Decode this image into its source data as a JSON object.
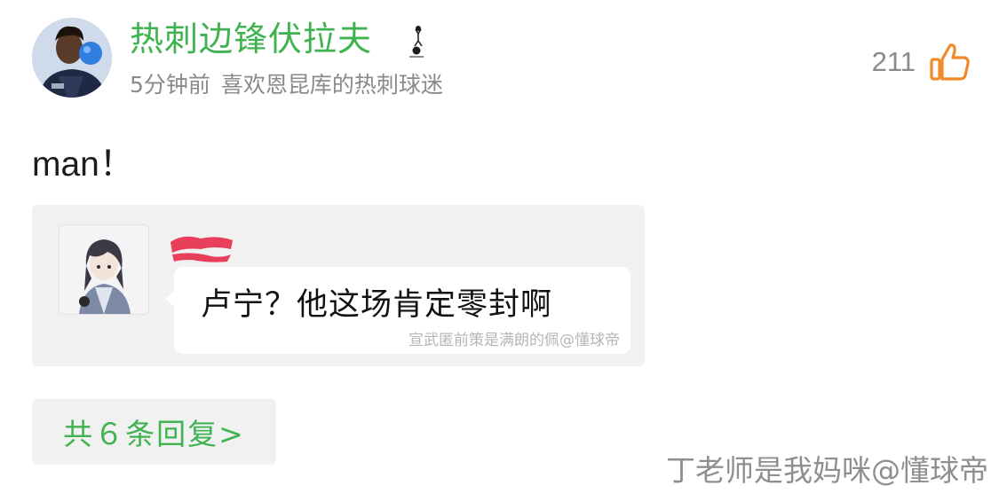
{
  "comment": {
    "author": {
      "name": "热刺边锋伏拉夫",
      "avatar_icon": "player-avatar-photo",
      "badge_icon": "tottenham-crest-icon"
    },
    "time": "5分钟前",
    "bio": "喜欢恩昆库的热刺球迷",
    "likes": "211",
    "like_icon": "thumbs-up-icon",
    "text": "man！",
    "quote": {
      "avatar_icon": "anime-character-avatar",
      "text": "卢宁？他这场肯定零封啊",
      "watermark": "宣武匿前策是满朗的佩@懂球帝"
    },
    "replies_label": "共６条回复>"
  },
  "watermark": "丁老师是我妈咪@懂球帝",
  "colors": {
    "accent_green": "#3fb34f",
    "like_orange": "#f08a2a",
    "secondary_text": "#8a8a8a",
    "card_background": "#f1f1f1"
  }
}
